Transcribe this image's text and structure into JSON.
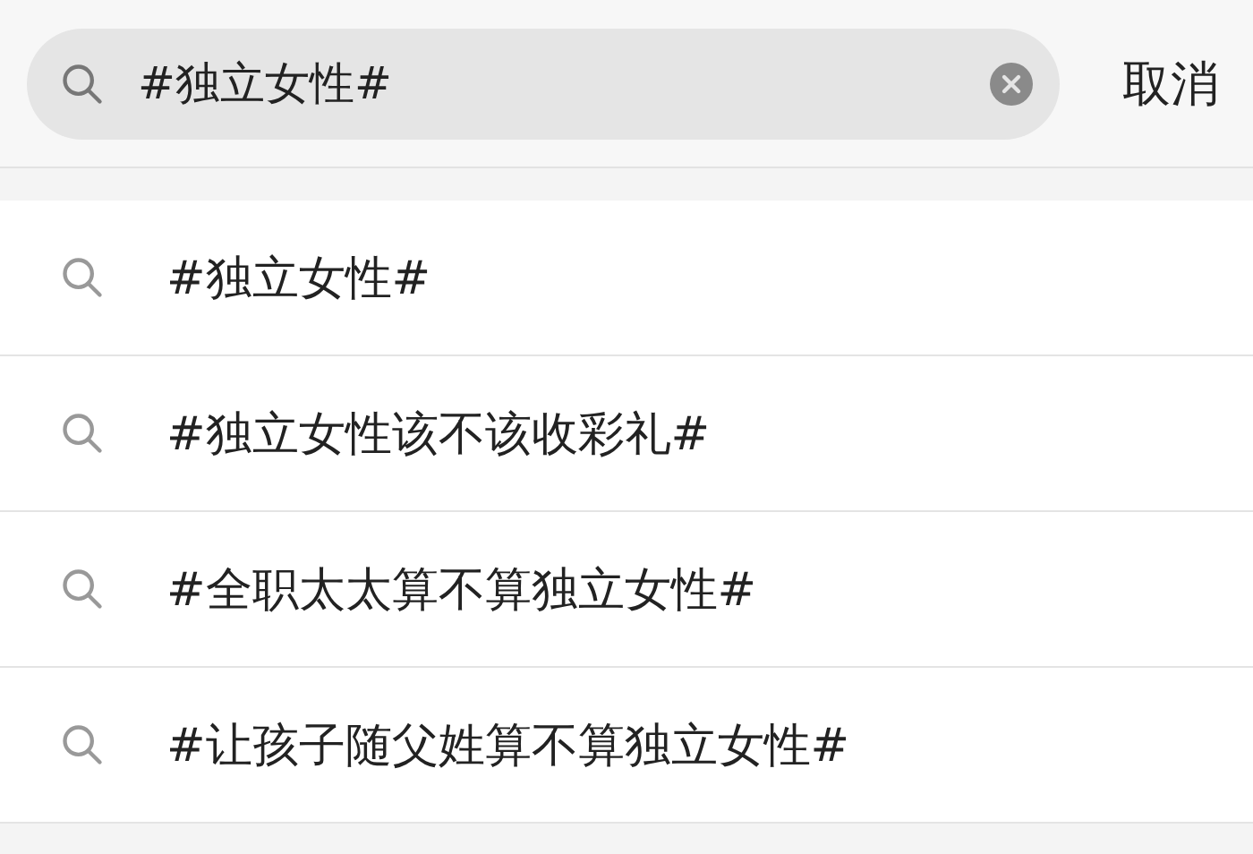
{
  "search": {
    "value": "#独立女性#"
  },
  "cancel": "取消",
  "suggestions": [
    {
      "text": "#独立女性#"
    },
    {
      "text": "#独立女性该不该收彩礼#"
    },
    {
      "text": "#全职太太算不算独立女性#"
    },
    {
      "text": "#让孩子随父姓算不算独立女性#"
    }
  ]
}
